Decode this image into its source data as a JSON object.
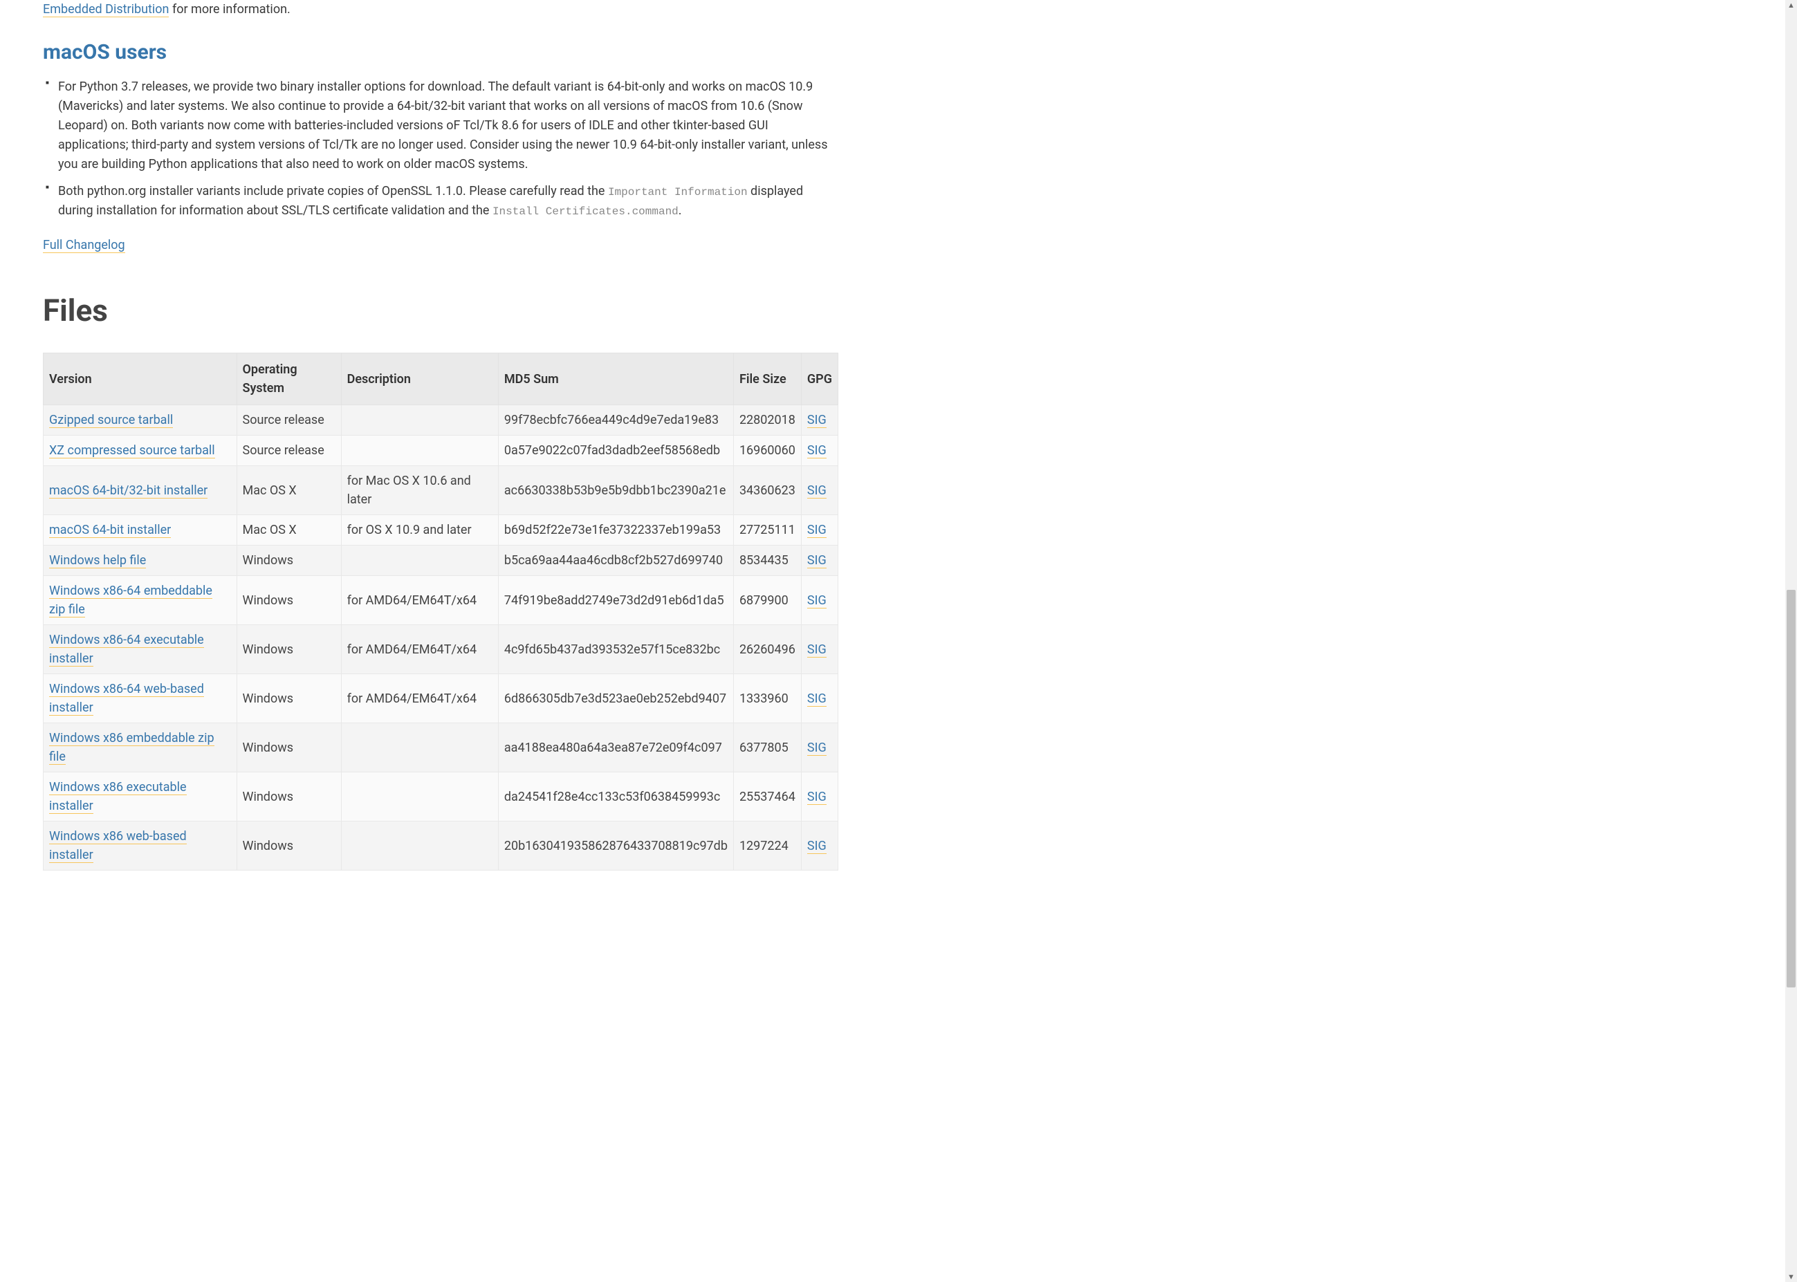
{
  "intro": {
    "link_text": "Embedded Distribution",
    "after": " for more information."
  },
  "macos": {
    "heading": "macOS users",
    "bullet1": "For Python 3.7 releases, we provide two binary installer options for download. The default variant is 64-bit-only and works on macOS 10.9 (Mavericks) and later systems. We also continue to provide a 64-bit/32-bit variant that works on all versions of macOS from 10.6 (Snow Leopard) on. Both variants now come with batteries-included versions oF Tcl/Tk 8.6 for users of IDLE and other tkinter-based GUI applications; third-party and system versions of Tcl/Tk are no longer used. Consider using the newer 10.9 64-bit-only installer variant, unless you are building Python applications that also need to work on older macOS systems.",
    "bullet2_before": "Both python.org installer variants include private copies of OpenSSL 1.1.0. Please carefully read the ",
    "bullet2_code1": "Important Information",
    "bullet2_mid": " displayed during installation for information about SSL/TLS certificate validation and the ",
    "bullet2_code2": "Install Certificates.command",
    "bullet2_after": "."
  },
  "changelog_link": "Full Changelog",
  "files": {
    "heading": "Files",
    "headers": {
      "version": "Version",
      "os": "Operating System",
      "desc": "Description",
      "md5": "MD5 Sum",
      "size": "File Size",
      "gpg": "GPG"
    },
    "sig_label": "SIG",
    "rows": [
      {
        "version": "Gzipped source tarball",
        "os": "Source release",
        "desc": "",
        "md5": "99f78ecbfc766ea449c4d9e7eda19e83",
        "size": "22802018"
      },
      {
        "version": "XZ compressed source tarball",
        "os": "Source release",
        "desc": "",
        "md5": "0a57e9022c07fad3dadb2eef58568edb",
        "size": "16960060"
      },
      {
        "version": "macOS 64-bit/32-bit installer",
        "os": "Mac OS X",
        "desc": "for Mac OS X 10.6 and later",
        "md5": "ac6630338b53b9e5b9dbb1bc2390a21e",
        "size": "34360623"
      },
      {
        "version": "macOS 64-bit installer",
        "os": "Mac OS X",
        "desc": "for OS X 10.9 and later",
        "md5": "b69d52f22e73e1fe37322337eb199a53",
        "size": "27725111"
      },
      {
        "version": "Windows help file",
        "os": "Windows",
        "desc": "",
        "md5": "b5ca69aa44aa46cdb8cf2b527d699740",
        "size": "8534435"
      },
      {
        "version": "Windows x86-64 embeddable zip file",
        "os": "Windows",
        "desc": "for AMD64/EM64T/x64",
        "md5": "74f919be8add2749e73d2d91eb6d1da5",
        "size": "6879900"
      },
      {
        "version": "Windows x86-64 executable installer",
        "os": "Windows",
        "desc": "for AMD64/EM64T/x64",
        "md5": "4c9fd65b437ad393532e57f15ce832bc",
        "size": "26260496"
      },
      {
        "version": "Windows x86-64 web-based installer",
        "os": "Windows",
        "desc": "for AMD64/EM64T/x64",
        "md5": "6d866305db7e3d523ae0eb252ebd9407",
        "size": "1333960"
      },
      {
        "version": "Windows x86 embeddable zip file",
        "os": "Windows",
        "desc": "",
        "md5": "aa4188ea480a64a3ea87e72e09f4c097",
        "size": "6377805"
      },
      {
        "version": "Windows x86 executable installer",
        "os": "Windows",
        "desc": "",
        "md5": "da24541f28e4cc133c53f0638459993c",
        "size": "25537464"
      },
      {
        "version": "Windows x86 web-based installer",
        "os": "Windows",
        "desc": "",
        "md5": "20b163041935862876433708819c97db",
        "size": "1297224"
      }
    ]
  }
}
